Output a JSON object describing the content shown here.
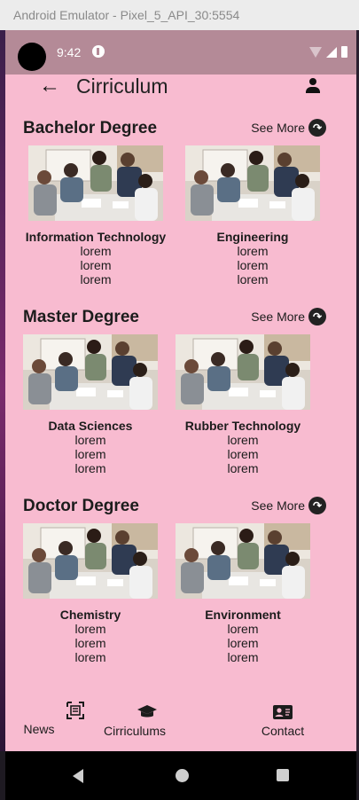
{
  "window": {
    "title": "Android Emulator - Pixel_5_API_30:5554"
  },
  "status_bar": {
    "time": "9:42"
  },
  "app_bar": {
    "title": "Cirriculum"
  },
  "see_more_label": "See More",
  "sections": [
    {
      "title": "Bachelor Degree",
      "cards": [
        {
          "title": "Information Technology",
          "lines": [
            "lorem",
            "lorem",
            "lorem"
          ]
        },
        {
          "title": "Engineering",
          "lines": [
            "lorem",
            "lorem",
            "lorem"
          ]
        }
      ]
    },
    {
      "title": "Master Degree",
      "cards": [
        {
          "title": "Data Sciences",
          "lines": [
            "lorem",
            "lorem",
            "lorem"
          ]
        },
        {
          "title": "Rubber Technology",
          "lines": [
            "lorem",
            "lorem",
            "lorem"
          ]
        }
      ]
    },
    {
      "title": "Doctor Degree",
      "cards": [
        {
          "title": "Chemistry",
          "lines": [
            "lorem",
            "lorem",
            "lorem"
          ]
        },
        {
          "title": "Environment",
          "lines": [
            "lorem",
            "lorem",
            "lorem"
          ]
        }
      ]
    }
  ],
  "bottom_nav": {
    "items": [
      {
        "label": "News",
        "icon": "news-icon"
      },
      {
        "label": "Cirriculums",
        "icon": "graduation-cap-icon"
      },
      {
        "label": "Contact",
        "icon": "contact-card-icon"
      }
    ]
  },
  "colors": {
    "background": "#f8bbd0",
    "status_bar": "#b48a97",
    "text": "#1c1c1c"
  }
}
